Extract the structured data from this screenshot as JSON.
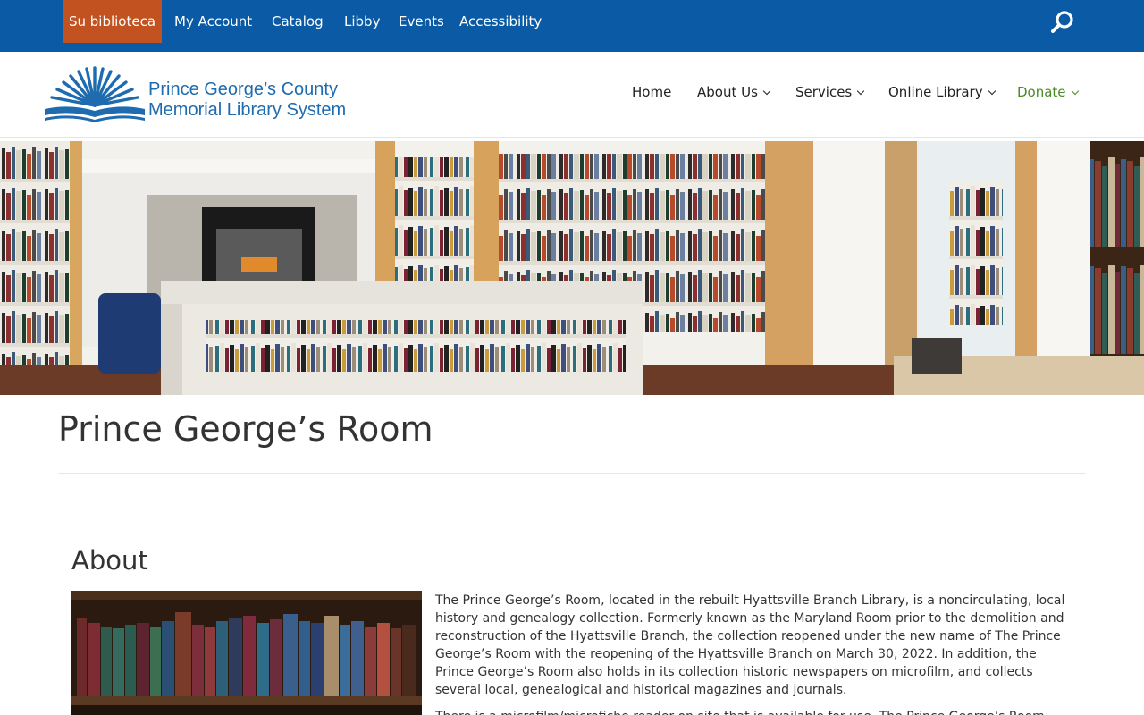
{
  "topbar": {
    "spanish_link": "Su biblioteca",
    "links": [
      "My Account",
      "Catalog",
      "Libby",
      "Events",
      "Accessibility"
    ],
    "search_icon": "search-icon",
    "color": "#0b5aa5",
    "accent": "#c2521f"
  },
  "logo": {
    "line1": "Prince George’s County",
    "line2": "Memorial Library System",
    "color": "#1f6bb0"
  },
  "nav": {
    "home": "Home",
    "about": "About Us",
    "services": "Services",
    "online": "Online Library",
    "donate": "Donate",
    "donate_color": "#4a8a24"
  },
  "page": {
    "title": "Prince George’s Room"
  },
  "about": {
    "heading": "About",
    "paragraph1": "The Prince George’s Room, located in the rebuilt Hyattsville Branch Library, is a noncirculating, local history and genealogy collection. Formerly known as the Maryland Room prior to the demolition and reconstruction of the Hyattsville Branch, the collection reopened under the new name of The Prince George’s Room with the reopening of the Hyattsville Branch on March 30, 2022. In addition, the Prince George’s Room also holds in its collection historic newspapers on microfilm, and collects several local, genealogical and historical magazines and journals.",
    "paragraph2": "There is a microfilm/microfiche reader on site that is available for use. The Prince George’s Room"
  }
}
